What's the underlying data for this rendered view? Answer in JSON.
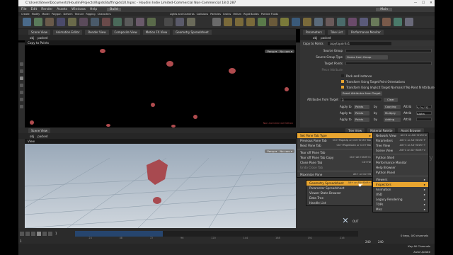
{
  "window": {
    "title": "C:\\Users\\Steve\\Documents\\HoudiniProjects\\RigidsStuff\\rigids10.hipnc - Houdini Indie Limited-Commercial Non-Commercial 18.0.287",
    "minimize": "—",
    "maximize": "☐",
    "close": "✕"
  },
  "menubar": {
    "items": [
      "File",
      "Edit",
      "Render",
      "Assets",
      "Windows",
      "Help"
    ],
    "build": "Build",
    "main": "Main"
  },
  "shelf": {
    "tabs": [
      "Create",
      "Modify",
      "Model",
      "Polygon",
      "Deform",
      "Texture",
      "Rigging",
      "Characters"
    ],
    "right_tabs": [
      "Lights and Cameras",
      "Collisions",
      "Particles",
      "Grains",
      "Vellum",
      "Rigid Bodies",
      "Particle Fluids"
    ]
  },
  "scene_pane": {
    "tabs": [
      "Scene View",
      "Animation Editor",
      "Render View",
      "Composite View",
      "Motion FX View",
      "Geometry Spreadsheet"
    ],
    "path": [
      "obj",
      "packed"
    ],
    "title": "Copy to Points",
    "persp": "Persp ▾",
    "cam": "No cam ▾",
    "watermark": "Non-Commercial Edition"
  },
  "params": {
    "tabs": [
      "Parameters",
      "Take List",
      "Performance Monitor"
    ],
    "path": [
      "obj",
      "packed"
    ],
    "node_type": "Copy to Points",
    "node_name": "copytopoints1",
    "source_group_label": "Source Group",
    "source_group_type_label": "Source Group Type",
    "source_group_type_value": "Guess from Group",
    "target_points_label": "Target Points",
    "piece_attribute_label": "Piece Attribute",
    "pack_label": "Pack and Instance",
    "transform_label": "Transform Using Target Point Orientations",
    "transform_implicit_label": "Transform Using Implicit Target Normals If No Point N Attribute",
    "reset_button": "Reset Attributes from Target",
    "attr_from_target_label": "Attributes from Target",
    "attr_count": "3",
    "clear_button": "Clear",
    "apply_rows": [
      {
        "apply_to": "Points",
        "op": "Copying",
        "attr": "Attrib",
        "value": "*,^v,^Q"
      },
      {
        "apply_to": "Points",
        "op": "Multiply",
        "attr": "Attrib",
        "value": "Alpha"
      },
      {
        "apply_to": "Points",
        "op": "Adding",
        "attr": "Attrib",
        "value": ""
      }
    ],
    "apply_to_label": "Apply to",
    "by_label": "by",
    "attrib_label": "Attrib"
  },
  "network_pane": {
    "tabs": [
      "Tree View",
      "Material Palette",
      "Asset Browser"
    ],
    "path": [
      "obj",
      "packed"
    ],
    "watermark": "try",
    "node_label": "OUT"
  },
  "view_pane": {
    "tabs": [
      "Scene View"
    ],
    "path": [
      "obj",
      "packed"
    ],
    "title": "View",
    "persp": "Persp ▾",
    "cam": "No cam ▾"
  },
  "context_menu": {
    "items": [
      {
        "label": "Set Pane Tab Type",
        "shortcut": "",
        "highlight": "orange",
        "arrow": "▸"
      },
      {
        "label": "Previous Pane Tab",
        "shortcut": "Ctrl+PageUp or Ctrl+Shift+Tab",
        "highlight": "",
        "arrow": ""
      },
      {
        "label": "Next Pane Tab",
        "shortcut": "Ctrl+PageDown or Ctrl+Tab",
        "highlight": "",
        "arrow": ""
      },
      {
        "sep": true
      },
      {
        "label": "Tear off Pane Tab",
        "shortcut": "",
        "highlight": "",
        "arrow": ""
      },
      {
        "label": "Tear off Pane Tab Copy",
        "shortcut": "Ctrl+Alt+Shift+C",
        "highlight": "",
        "arrow": ""
      },
      {
        "label": "Close Pane Tab",
        "shortcut": "Ctrl+W",
        "highlight": "",
        "arrow": ""
      },
      {
        "label": "Undo Close Tab",
        "shortcut": "",
        "highlight": "",
        "arrow": ""
      },
      {
        "sep": true
      },
      {
        "label": "Maximize Pane",
        "shortcut": "Alt+ or Ctrl+B",
        "highlight": "",
        "arrow": ""
      }
    ]
  },
  "submenu_left": {
    "items": [
      {
        "label": "Geometry Spreadsheet",
        "shortcut": "Alt+ or Alt+Shift+S",
        "highlight": "orange"
      },
      {
        "label": "Parameter Spreadsheet",
        "shortcut": "",
        "highlight": ""
      },
      {
        "label": "Viewer State Browser",
        "shortcut": "",
        "highlight": ""
      },
      {
        "label": "Data Tree",
        "shortcut": "",
        "highlight": ""
      },
      {
        "label": "Handle List",
        "shortcut": "",
        "highlight": ""
      }
    ]
  },
  "submenu_right": {
    "items": [
      {
        "label": "Network View",
        "shortcut": "Alt+1 or Alt+Shift+N",
        "highlight": ""
      },
      {
        "label": "Parameters",
        "shortcut": "Alt+2 or Alt+Shift+P",
        "highlight": ""
      },
      {
        "label": "Tree View",
        "shortcut": "Alt+3 or Alt+Shift+T",
        "highlight": ""
      },
      {
        "label": "Scene View",
        "shortcut": "Alt+4 or Alt+Shift+V",
        "highlight": ""
      }
    ],
    "items2": [
      {
        "label": "Python Shell",
        "highlight": ""
      },
      {
        "label": "Performance Monitor",
        "highlight": ""
      },
      {
        "label": "Help Browser",
        "highlight": ""
      },
      {
        "label": "Python Panel",
        "highlight": ""
      }
    ],
    "items3": [
      {
        "label": "Viewers",
        "highlight": ""
      },
      {
        "label": "Inspectors",
        "highlight": "orange"
      },
      {
        "label": "Animation",
        "highlight": ""
      },
      {
        "label": "USD",
        "highlight": ""
      },
      {
        "label": "Legacy Rendering",
        "highlight": ""
      },
      {
        "label": "TOPs",
        "highlight": ""
      },
      {
        "label": "Misc",
        "highlight": ""
      }
    ]
  },
  "timeline": {
    "frame": "1",
    "start": "1",
    "end": "240",
    "end2": "240",
    "ticks": [
      "24",
      "48",
      "72",
      "96",
      "120",
      "144",
      "168",
      "192",
      "216"
    ],
    "progress": 0.31
  },
  "status": {
    "keys": "0 keys, 0/0 channels",
    "key_all": "Key All Channels",
    "auto_update": "Auto Update"
  },
  "colors": {
    "accent": "#e8a530",
    "geometry": "#b04b4e"
  }
}
